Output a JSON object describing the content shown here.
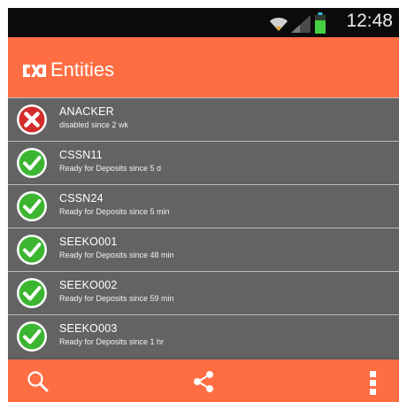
{
  "status_bar": {
    "time": "12:48",
    "icons": [
      "wifi-icon",
      "signal-icon",
      "battery-icon"
    ]
  },
  "action_bar": {
    "title": "Entities",
    "logo_icon": "cx-logo-icon"
  },
  "entities": [
    {
      "name": "ANACKER",
      "status_text": "disabled since 2 wk",
      "state": "disabled",
      "icon": "error-x-icon"
    },
    {
      "name": "CSSN11",
      "status_text": "Ready for Deposits since 5 d",
      "state": "ready",
      "icon": "check-icon"
    },
    {
      "name": "CSSN24",
      "status_text": "Ready for Deposits since 5 min",
      "state": "ready",
      "icon": "check-icon"
    },
    {
      "name": "SEEKO001",
      "status_text": "Ready for Deposits since 48 min",
      "state": "ready",
      "icon": "check-icon"
    },
    {
      "name": "SEEKO002",
      "status_text": "Ready for Deposits since 59 min",
      "state": "ready",
      "icon": "check-icon"
    },
    {
      "name": "SEEKO003",
      "status_text": "Ready for Deposits since 1 hr",
      "state": "ready",
      "icon": "check-icon"
    }
  ],
  "bottom_bar": {
    "actions": [
      "search-icon",
      "share-icon",
      "overflow-menu-icon"
    ]
  },
  "colors": {
    "accent": "#ff6d42",
    "list_bg": "#636363",
    "status_ok": "#3cb531",
    "status_error": "#d42b2b"
  }
}
